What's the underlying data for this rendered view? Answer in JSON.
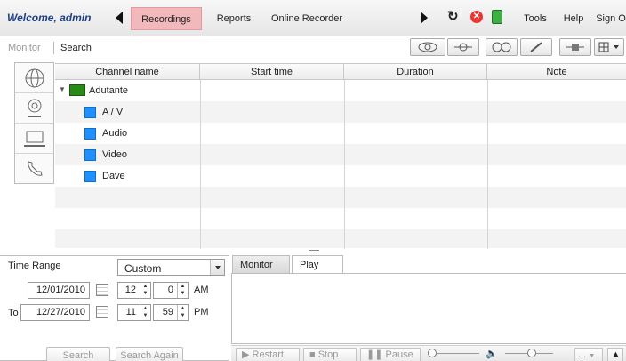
{
  "topbar": {
    "welcome": "Welcome, admin",
    "tabs": [
      {
        "label": "Recordings",
        "active": true
      },
      {
        "label": "Reports"
      },
      {
        "label": "Online Recorder"
      },
      {
        "label": "Tools"
      },
      {
        "label": "Help"
      },
      {
        "label": "Sign Off"
      }
    ],
    "icons": [
      "arrow-left-icon",
      "arrow-right-icon",
      "refresh-icon",
      "close-red-icon",
      "green-device-icon"
    ]
  },
  "subbar": {
    "monitor": "Monitor",
    "search": "Search",
    "tools": [
      "view-icon",
      "line-icon",
      "glasses-icon",
      "pencil-icon",
      "link-icon",
      "grid-icon"
    ]
  },
  "leftpanel": {
    "icons": [
      "globe-icon",
      "webcam-icon",
      "laptop-icon",
      "phone-icon"
    ]
  },
  "grid": {
    "columns": [
      "Channel name",
      "Start time",
      "Duration",
      "Note"
    ],
    "root": "Adutante",
    "children": [
      "A / V",
      "Audio",
      "Video",
      "Dave"
    ]
  },
  "timerange": {
    "label": "Time Range",
    "select": "Custom",
    "from_date": "12/01/2010",
    "from_hour": "12",
    "from_min": "0",
    "from_ampm": "AM",
    "to_label": "To",
    "to_date": "12/27/2010",
    "to_hour": "11",
    "to_min": "59",
    "to_ampm": "PM",
    "search_btn": "Search",
    "search_again_btn": "Search Again"
  },
  "player": {
    "tabs": [
      "Monitor",
      "Play"
    ],
    "restart": "Restart",
    "stop": "Stop",
    "pause": "Pause",
    "more": "..."
  },
  "colors": {
    "accent_tab": "#f2b9bd",
    "channel_root": "#2a8a17",
    "channel_child": "#1e90ff",
    "welcome_text": "#1d3f86"
  }
}
